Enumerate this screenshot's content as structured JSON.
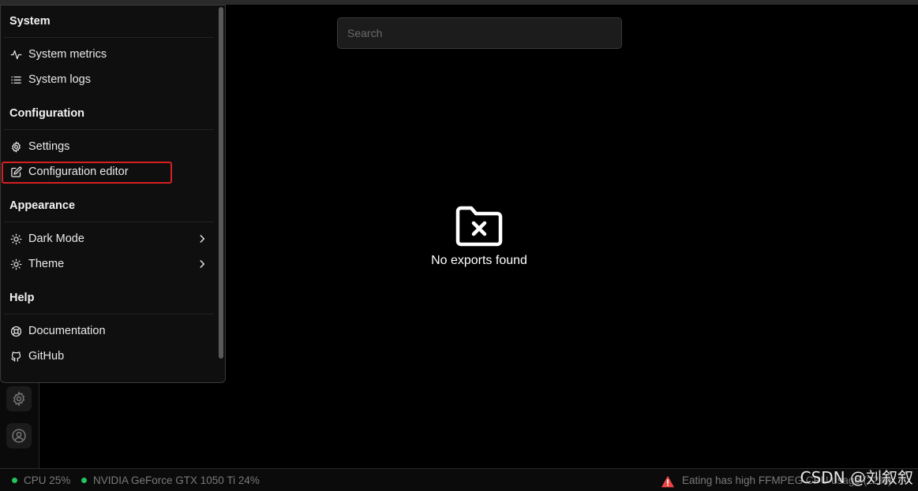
{
  "search": {
    "placeholder": "Search"
  },
  "empty_state": {
    "icon": "folder-x-icon",
    "message": "No exports found"
  },
  "menu": {
    "sections": [
      {
        "title": "System",
        "items": [
          {
            "label": "System metrics",
            "icon": "activity-icon"
          },
          {
            "label": "System logs",
            "icon": "list-icon"
          }
        ]
      },
      {
        "title": "Configuration",
        "items": [
          {
            "label": "Settings",
            "icon": "gear-icon"
          },
          {
            "label": "Configuration editor",
            "icon": "edit-icon",
            "highlighted": true
          }
        ]
      },
      {
        "title": "Appearance",
        "items": [
          {
            "label": "Dark Mode",
            "icon": "sun-icon",
            "submenu": true
          },
          {
            "label": "Theme",
            "icon": "sun-icon",
            "submenu": true
          }
        ]
      },
      {
        "title": "Help",
        "items": [
          {
            "label": "Documentation",
            "icon": "lifebuoy-icon"
          },
          {
            "label": "GitHub",
            "icon": "github-icon"
          }
        ]
      }
    ]
  },
  "statusbar": {
    "cpu": "CPU 25%",
    "gpu": "NVIDIA GeForce GTX 1050 Ti 24%",
    "warning": "Eating has high FFMPEG CPU usage (22%)",
    "status_color": "#22c55e",
    "warning_color": "#ef4444"
  },
  "watermark": "CSDN @刘叙叙",
  "colors": {
    "highlight_border": "#d62020",
    "background": "#000000"
  }
}
